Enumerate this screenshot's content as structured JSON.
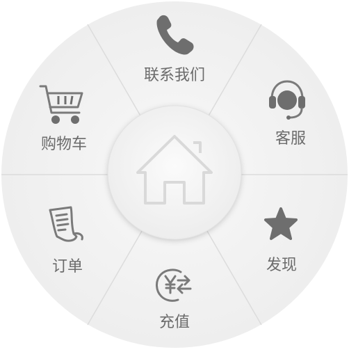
{
  "menu": {
    "center": {
      "icon": "home-icon"
    },
    "items": [
      {
        "label": "联系我们",
        "icon": "phone-icon"
      },
      {
        "label": "客服",
        "icon": "headset-icon"
      },
      {
        "label": "发现",
        "icon": "star-icon"
      },
      {
        "label": "充值",
        "icon": "yen-recharge-icon"
      },
      {
        "label": "订单",
        "icon": "order-document-icon"
      },
      {
        "label": "购物车",
        "icon": "shopping-cart-icon"
      }
    ]
  },
  "colors": {
    "ring": "#f3f3f3",
    "divider": "#d9d9d9",
    "center": "#f7f7f7",
    "icon": "#6e6e6e",
    "label": "#6b6b6b",
    "center_icon": "#dcdcdc"
  }
}
